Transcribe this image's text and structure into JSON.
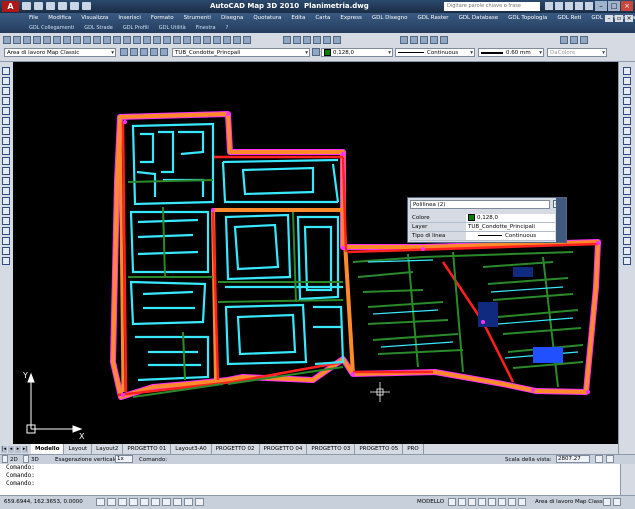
{
  "window": {
    "title": "AutoCAD Map 3D 2010",
    "document": "Planimetria.dwg",
    "search_placeholder": "Digitare parole chiave o frase",
    "logo": "A"
  },
  "menus": {
    "row1": [
      "File",
      "Modifica",
      "Visualizza",
      "Inserisci",
      "Formato",
      "Strumenti",
      "Disegna",
      "Quotatura",
      "Edita",
      "Carta",
      "Express",
      "GDL Disegno",
      "GDL Raster",
      "GDL Database",
      "GDL Topologia",
      "GDL Reti",
      "GDL Cartografia"
    ],
    "row2": [
      "GDL Collegamenti",
      "GDL Strade",
      "GDL Profili",
      "GDL Utilità",
      "Finestra",
      "?"
    ]
  },
  "toolbar": {
    "workspace": "Area di lavoro Map Classic",
    "layer_current": "TUB_Condotte_Princpali",
    "color_current": "0,128,0",
    "linetype_current": "Continuous",
    "lineweight_current": "0.60 mm",
    "plotstyle_current": "DaColore"
  },
  "quick_properties": {
    "object_type": "Polilinea (2)",
    "rows": [
      {
        "key": "Colore",
        "value": "0,128,0"
      },
      {
        "key": "Layer",
        "value": "TUB_Condotte_Principali"
      },
      {
        "key": "Tipo di linea",
        "value": "Continuous"
      }
    ]
  },
  "layout_tabs": [
    "Modello",
    "Layout",
    "Layout2",
    "PROGETTO 01",
    "Layout3-A0",
    "PROGETTO 02",
    "PROGETTO 04",
    "PROGETTO 03",
    "PROGETTO 05",
    "PRO"
  ],
  "status1": {
    "mode": "2D",
    "mode3d": "3D",
    "exaggeration_label": "Esagerazione verticale:",
    "exaggeration_value": "1x",
    "command_label": "Comando:",
    "scale_label": "Scala della vista:",
    "scale_value": "2807.27"
  },
  "command_lines": [
    "Comando:",
    "Comando:",
    "",
    "Comando:"
  ],
  "status2": {
    "coordinates": "659.6944, 162.3653, 0.0000",
    "space": "MODELLO",
    "workspace": "Area di lavoro Map Classic"
  },
  "ucs": {
    "x": "X",
    "y": "Y"
  },
  "colors": {
    "pipe_main": "#ff2020",
    "pipe_secondary": "#2a8a2a",
    "road": "#ff8a2a",
    "block": "#38e8ff",
    "magenta": "#ff30ff",
    "blue": "#2050ff"
  }
}
